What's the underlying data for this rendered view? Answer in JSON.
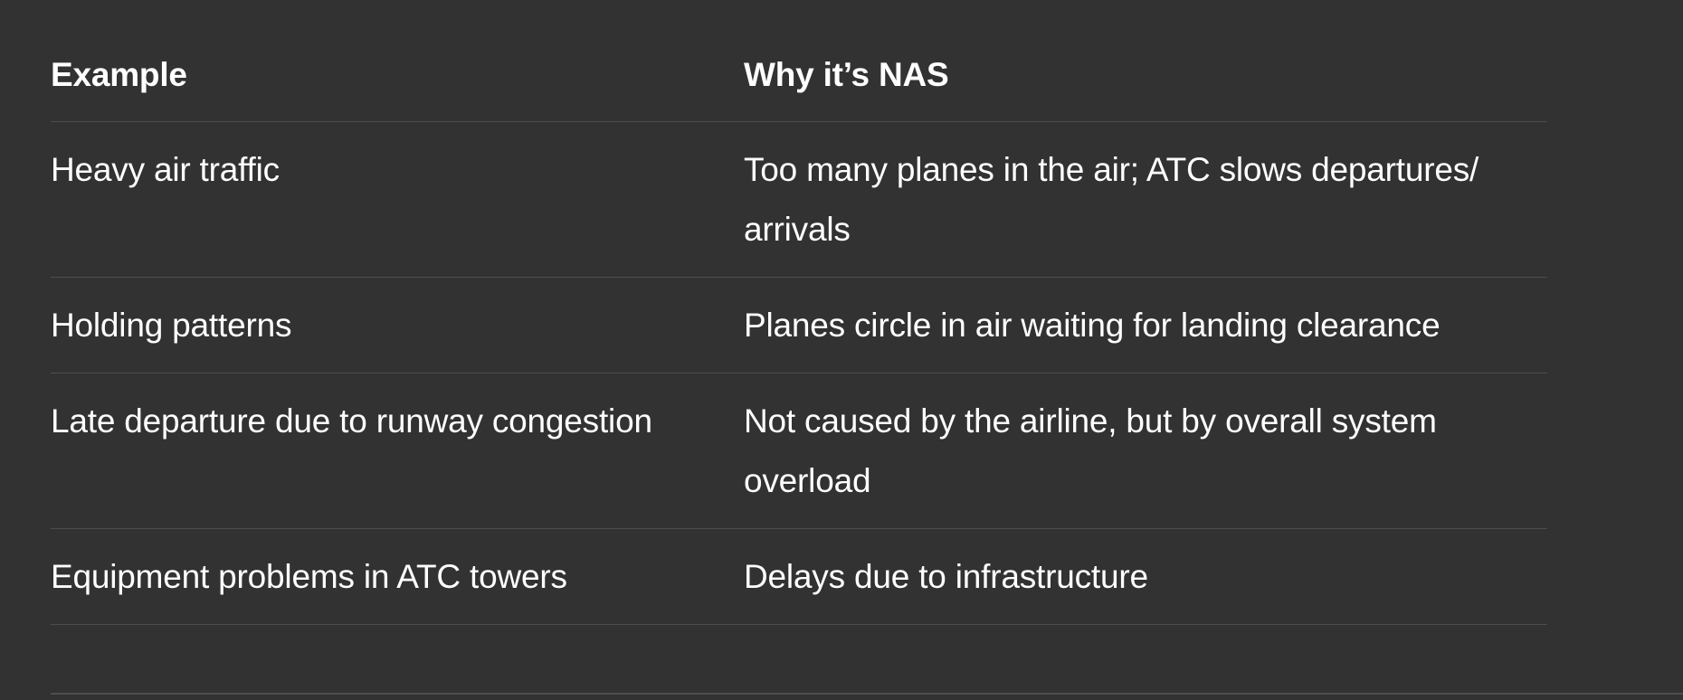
{
  "table": {
    "headers": {
      "example": "Example",
      "why": "Why it’s NAS"
    },
    "rows": [
      {
        "example": "Heavy air traffic",
        "why": "Too many planes in the air; ATC slows departures/ arrivals"
      },
      {
        "example": "Holding patterns",
        "why": "Planes circle in air waiting for landing clearance"
      },
      {
        "example": "Late departure due to runway congestion",
        "why": "Not caused by the airline, but by overall system overload"
      },
      {
        "example": "Equipment problems in ATC towers",
        "why": "Delays due to infrastructure"
      }
    ]
  },
  "colors": {
    "background": "#323232",
    "text": "#ffffff",
    "divider": "#4d4d4d"
  }
}
